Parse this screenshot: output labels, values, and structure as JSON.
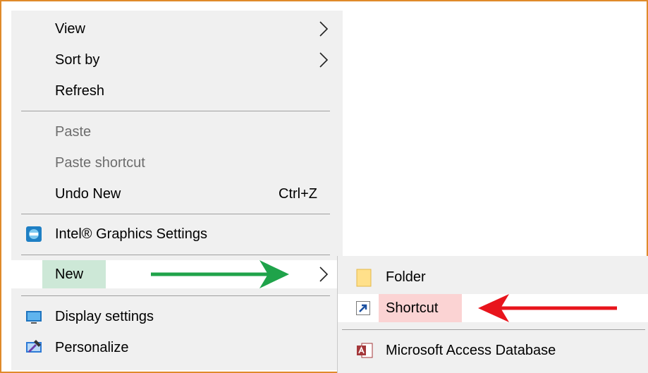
{
  "menu": {
    "view": "View",
    "sort_by": "Sort by",
    "refresh": "Refresh",
    "paste": "Paste",
    "paste_shortcut": "Paste shortcut",
    "undo_new": "Undo New",
    "undo_shortcut": "Ctrl+Z",
    "intel_graphics": "Intel® Graphics Settings",
    "new": "New",
    "display_settings": "Display settings",
    "personalize": "Personalize"
  },
  "submenu": {
    "folder": "Folder",
    "shortcut": "Shortcut",
    "access_db": "Microsoft Access Database"
  },
  "colors": {
    "frame": "#e08a2a",
    "green_arrow": "#1fa34a",
    "red_arrow": "#e8141c",
    "new_highlight": "#cde8d7",
    "shortcut_highlight": "#fbd3d3"
  }
}
